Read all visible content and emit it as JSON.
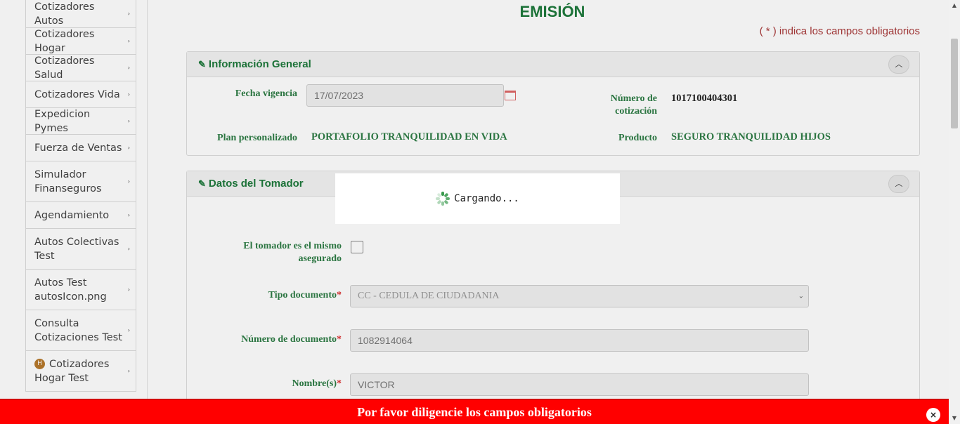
{
  "sidebar": {
    "items": [
      {
        "label": "Cotizadores Autos"
      },
      {
        "label": "Cotizadores Hogar"
      },
      {
        "label": "Cotizadores Salud"
      },
      {
        "label": "Cotizadores Vida"
      },
      {
        "label": "Expedicion Pymes"
      },
      {
        "label": "Fuerza de Ventas"
      },
      {
        "label": "Simulador Finanseguros"
      },
      {
        "label": "Agendamiento"
      },
      {
        "label": "Autos Colectivas Test"
      },
      {
        "label": "Autos Test autosIcon.png"
      },
      {
        "label": "Consulta Cotizaciones Test"
      },
      {
        "label": "Cotizadores Hogar Test",
        "icon_text": "H"
      }
    ],
    "chevron": "›"
  },
  "main": {
    "title": "EMISIÓN",
    "required_note": "( * ) indica los campos obligatorios",
    "general": {
      "title": "Información General",
      "fecha_label": "Fecha vigencia",
      "fecha_value": "17/07/2023",
      "cotizacion_label": "Número de cotización",
      "cotizacion_value": "1017100404301",
      "plan_label": "Plan personalizado",
      "plan_value": "PORTAFOLIO TRANQUILIDAD EN VIDA",
      "producto_label": "Producto",
      "producto_value": "SEGURO TRANQUILIDAD HIJOS"
    },
    "tomador": {
      "title": "Datos del Tomador",
      "mismo_label": "El tomador es el mismo asegurado",
      "tipo_doc_label": "Tipo documento",
      "tipo_doc_value": "CC - CEDULA DE CIUDADANIA",
      "num_doc_label": "Número de documento",
      "num_doc_value": "1082914064",
      "nombre_label": "Nombre(s)",
      "nombre_value": "VICTOR"
    },
    "required_mark": "*"
  },
  "loading": {
    "text": "Cargando..."
  },
  "alert": {
    "text": "Por favor diligencie los campos obligatorios",
    "close": "×"
  },
  "colors": {
    "accent": "#1e7a3c",
    "alert": "#ff0000",
    "required": "#a93a3a"
  }
}
